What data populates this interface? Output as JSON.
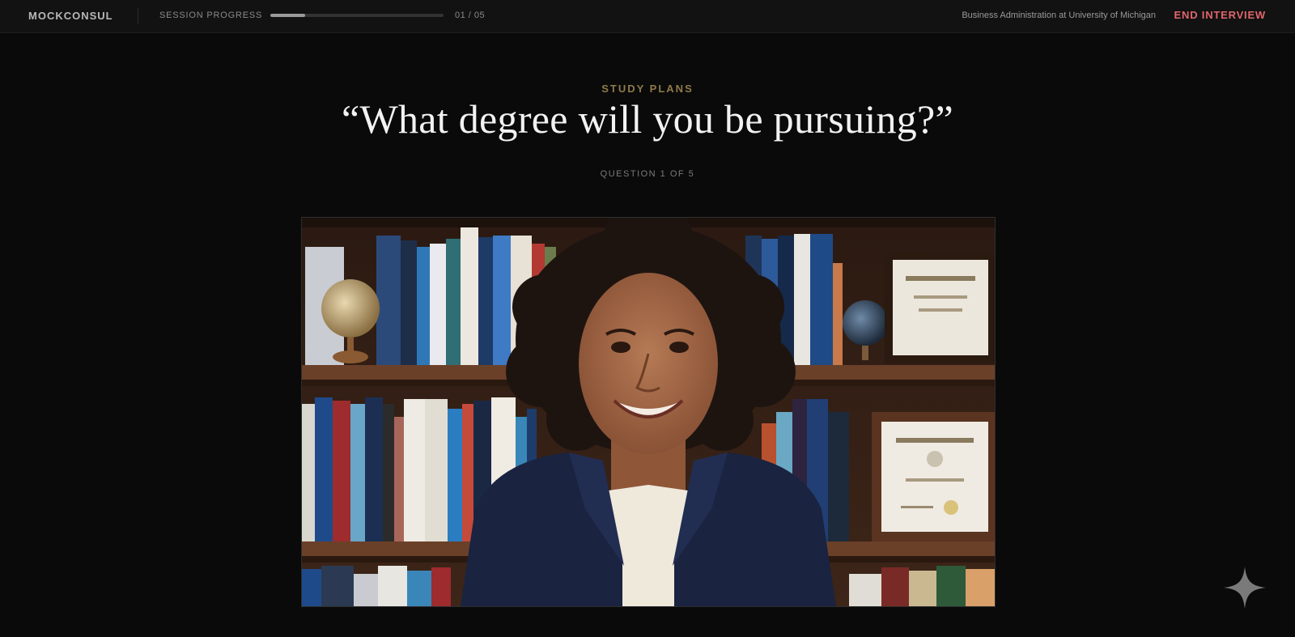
{
  "header": {
    "brand": "MOCKCONSUL",
    "progress_label": "SESSION PROGRESS",
    "progress_fraction": 0.2,
    "progress_count": "01 / 05",
    "program": "Business Administration at University of Michigan",
    "end_button": "END INTERVIEW"
  },
  "question": {
    "category": "STUDY PLANS",
    "text": "“What degree will you be pursuing?”",
    "counter": "QUESTION 1 OF 5"
  },
  "colors": {
    "accent_gold": "#8f7a4a",
    "end_red": "#e0666c",
    "background": "#0a0a0a"
  },
  "icons": {
    "corner": "sparkle-icon"
  }
}
